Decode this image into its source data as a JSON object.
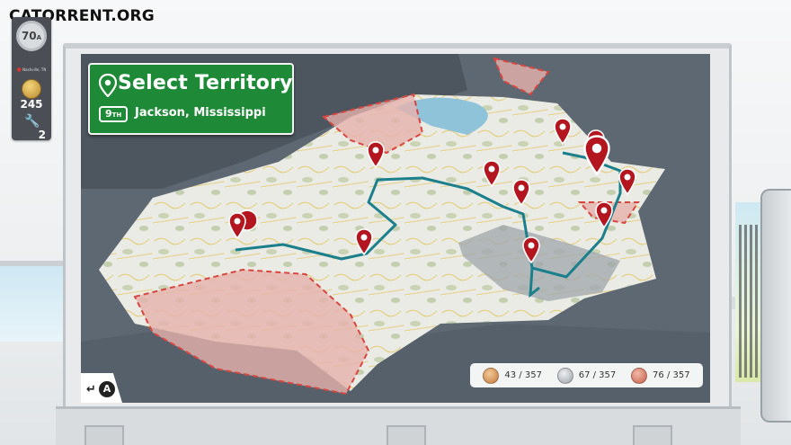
{
  "site": {
    "logo_text": "CATORRENT.ORG"
  },
  "hud": {
    "level": "70",
    "level_suffix": "A",
    "location": "Nashville, TN",
    "coins": "245",
    "tools": "2"
  },
  "title_sign": {
    "title": "Select Territory",
    "rank_number": "9",
    "rank_suffix": "TH",
    "city": "Jackson, Mississippi"
  },
  "back_button": {
    "arrow": "↵",
    "button": "A"
  },
  "collectibles": [
    {
      "icon": "bronze-coin-icon",
      "color": "#e2a36b",
      "text": "43 / 357"
    },
    {
      "icon": "silver-coin-icon",
      "color": "#c9cdd1",
      "text": "67 / 357"
    },
    {
      "icon": "copper-coin-icon",
      "color": "#e59a86",
      "text": "76 / 357"
    }
  ],
  "colors": {
    "sign_green": "#1e8a37",
    "pin_red": "#b3161f",
    "route_teal": "#1b7f8c",
    "restricted_red": "#d96a6a"
  }
}
